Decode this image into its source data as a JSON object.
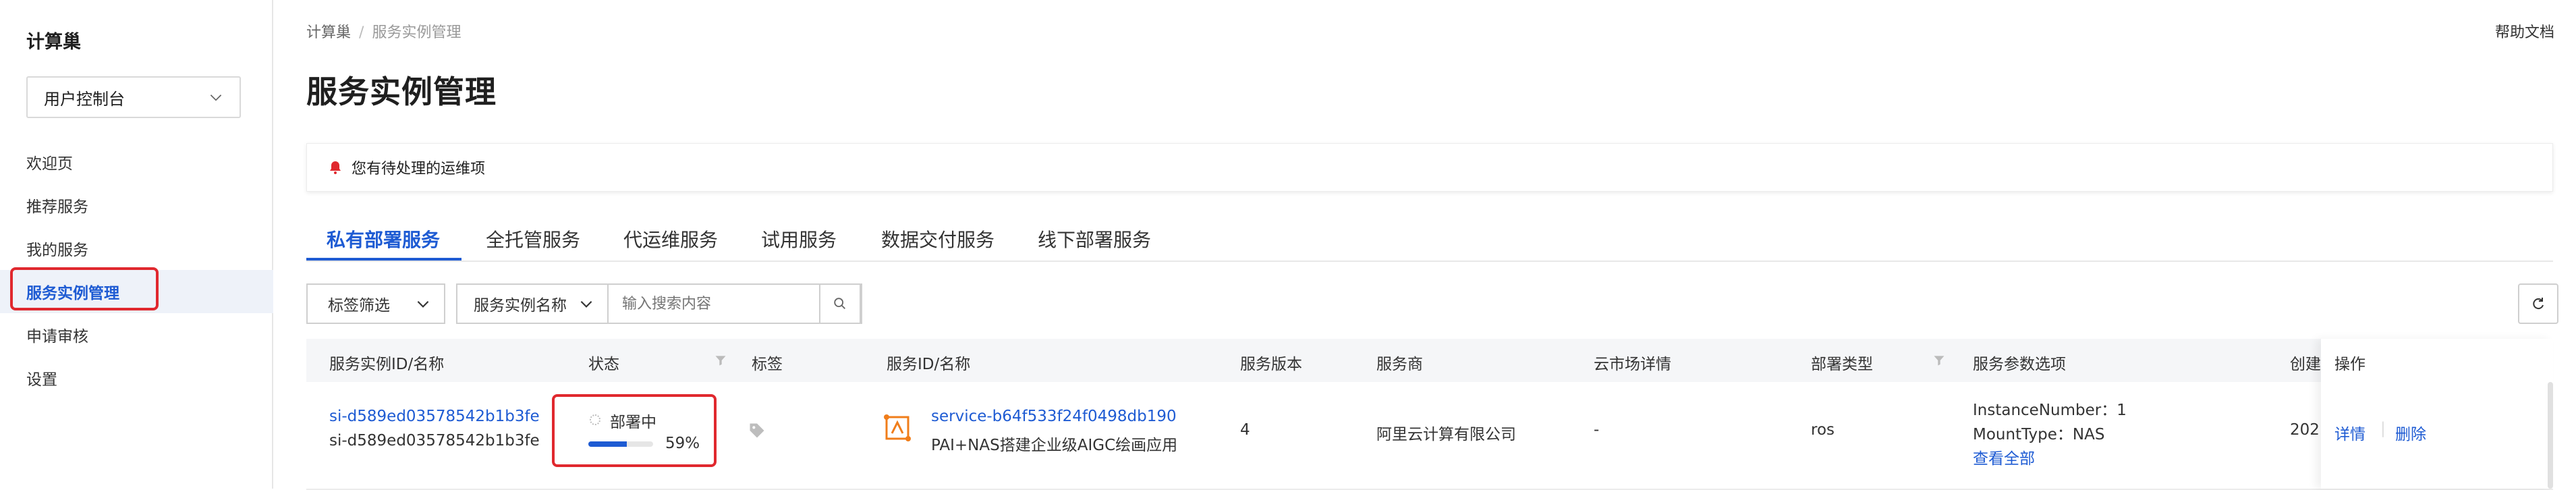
{
  "sidebar": {
    "brand": "计算巢",
    "console_select": "用户控制台",
    "items": [
      {
        "label": "欢迎页"
      },
      {
        "label": "推荐服务"
      },
      {
        "label": "我的服务"
      },
      {
        "label": "服务实例管理"
      },
      {
        "label": "申请审核"
      },
      {
        "label": "设置"
      }
    ]
  },
  "header": {
    "breadcrumb": [
      "计算巢",
      "服务实例管理"
    ],
    "help": "帮助文档",
    "title": "服务实例管理"
  },
  "notice": {
    "text": "您有待处理的运维项"
  },
  "tabs": [
    "私有部署服务",
    "全托管服务",
    "代运维服务",
    "试用服务",
    "数据交付服务",
    "线下部署服务"
  ],
  "filters": {
    "tag_filter": "标签筛选",
    "field_select": "服务实例名称",
    "search_placeholder": "输入搜索内容"
  },
  "table": {
    "columns": [
      "服务实例ID/名称",
      "状态",
      "标签",
      "服务ID/名称",
      "服务版本",
      "服务商",
      "云市场详情",
      "部署类型",
      "服务参数选项",
      "创建",
      "操作"
    ],
    "row": {
      "instance_id": "si-d589ed03578542b1b3fe",
      "instance_name": "si-d589ed03578542b1b3fe",
      "status": "部署中",
      "progress_text": "59%",
      "progress": 0.59,
      "service_id": "service-b64f533f24f0498db190",
      "service_name": "PAI+NAS搭建企业级AIGC绘画应用",
      "version": "4",
      "provider": "阿里云计算有限公司",
      "market": "-",
      "deploy_type": "ros",
      "params": [
        "InstanceNumber：1",
        "MountType：NAS"
      ],
      "params_more": "查看全部",
      "created": "202",
      "actions": {
        "detail": "详情",
        "delete": "删除"
      }
    }
  },
  "colors": {
    "accent": "#1e5bd3",
    "highlight": "#e0282e",
    "service_icon": "#f07d1a"
  },
  "icons": [
    "chevron-down-icon",
    "bell-icon",
    "search-icon",
    "refresh-icon",
    "filter-icon",
    "tag-icon",
    "service-icon"
  ]
}
